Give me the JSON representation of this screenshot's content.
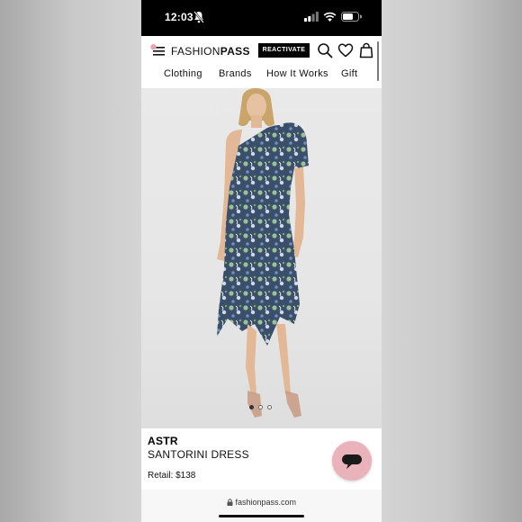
{
  "status_bar": {
    "time": "12:03",
    "icons": [
      "bell-slash-icon",
      "signal-icon",
      "wifi-icon",
      "battery-icon"
    ]
  },
  "header": {
    "logo": {
      "light": "FASHION",
      "bold": "PASS"
    },
    "reactivate_label": "REACTIVATE",
    "icons": [
      "menu-icon",
      "search-icon",
      "heart-icon",
      "shopping-bag-icon"
    ],
    "notification_color": "#e8a3b1"
  },
  "nav": {
    "items": [
      {
        "label": "Clothing"
      },
      {
        "label": "Brands"
      },
      {
        "label": "How It Works"
      },
      {
        "label": "Gift"
      }
    ]
  },
  "product": {
    "image_alt": "Model wearing a one-shoulder floral midi dress with asymmetric ruffle hem",
    "carousel": {
      "count": 3,
      "active_index": 0
    },
    "brand": "ASTR",
    "name": "SANTORINI DRESS",
    "price": "Retail: $138"
  },
  "chat": {
    "icon": "chat-bubble-icon",
    "color": "#eab3bc"
  },
  "browser": {
    "url": "fashionpass.com",
    "icon": "lock-icon"
  }
}
